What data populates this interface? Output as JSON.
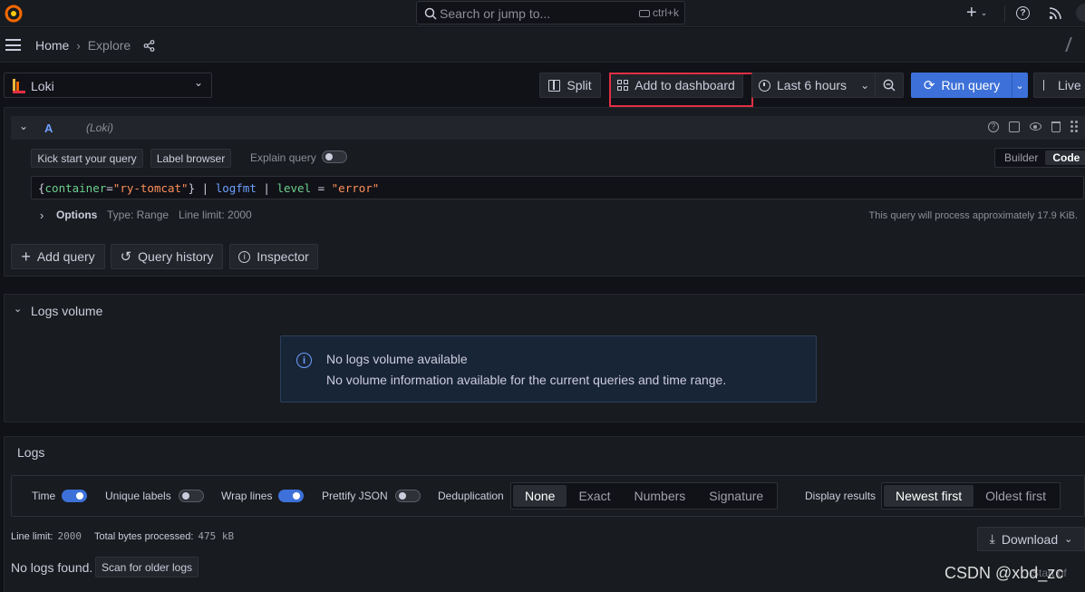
{
  "topbar": {
    "search_placeholder": "Search or jump to...",
    "search_shortcut": "ctrl+k",
    "plus_label": "+"
  },
  "breadcrumb": {
    "home": "Home",
    "current": "Explore"
  },
  "toolbar": {
    "datasource": "Loki",
    "split": "Split",
    "add_to_dashboard": "Add to dashboard",
    "time_range": "Last 6 hours",
    "run_query": "Run query",
    "live": "Live"
  },
  "query": {
    "ref": "A",
    "datasource_tag": "(Loki)",
    "kick_start": "Kick start your query",
    "label_browser": "Label browser",
    "explain_query": "Explain query",
    "mode_builder": "Builder",
    "mode_code": "Code",
    "expr_parts": [
      {
        "t": "{",
        "c": "#ccccdc"
      },
      {
        "t": "container",
        "c": "#6ccf8e"
      },
      {
        "t": "=",
        "c": "#ccccdc"
      },
      {
        "t": "\"ry-tomcat\"",
        "c": "#ff8f5a"
      },
      {
        "t": "} | ",
        "c": "#ccccdc"
      },
      {
        "t": "logfmt",
        "c": "#6e9fff"
      },
      {
        "t": " | ",
        "c": "#ccccdc"
      },
      {
        "t": "level",
        "c": "#6ccf8e"
      },
      {
        "t": " = ",
        "c": "#ccccdc"
      },
      {
        "t": "\"error\"",
        "c": "#ff8f5a"
      }
    ],
    "options_label": "Options",
    "options_type": "Type: Range",
    "options_limit": "Line limit: 2000",
    "process_info": "This query will process approximately 17.9 KiB."
  },
  "actions": {
    "add_query": "Add query",
    "query_history": "Query history",
    "inspector": "Inspector"
  },
  "logs_volume": {
    "title": "Logs volume",
    "alert_title": "No logs volume available",
    "alert_body": "No volume information available for the current queries and time range."
  },
  "logs": {
    "title": "Logs",
    "time": "Time",
    "unique_labels": "Unique labels",
    "wrap_lines": "Wrap lines",
    "prettify_json": "Prettify JSON",
    "dedup_label": "Deduplication",
    "dedup_options": [
      "None",
      "Exact",
      "Numbers",
      "Signature"
    ],
    "display_results": "Display results",
    "order_options": [
      "Newest first",
      "Oldest first"
    ],
    "line_limit_label": "Line limit:",
    "line_limit_value": "2000",
    "bytes_label": "Total bytes processed:",
    "bytes_value": "475 kB",
    "download": "Download",
    "no_logs": "No logs found.",
    "scan_older": "Scan for older logs",
    "start_of": "Start of"
  },
  "watermark": "CSDN @xbd_zc",
  "colors": {
    "accent": "#3d71d9",
    "highlight_box": "#e02f44",
    "info_icon": "#6e9fff"
  }
}
